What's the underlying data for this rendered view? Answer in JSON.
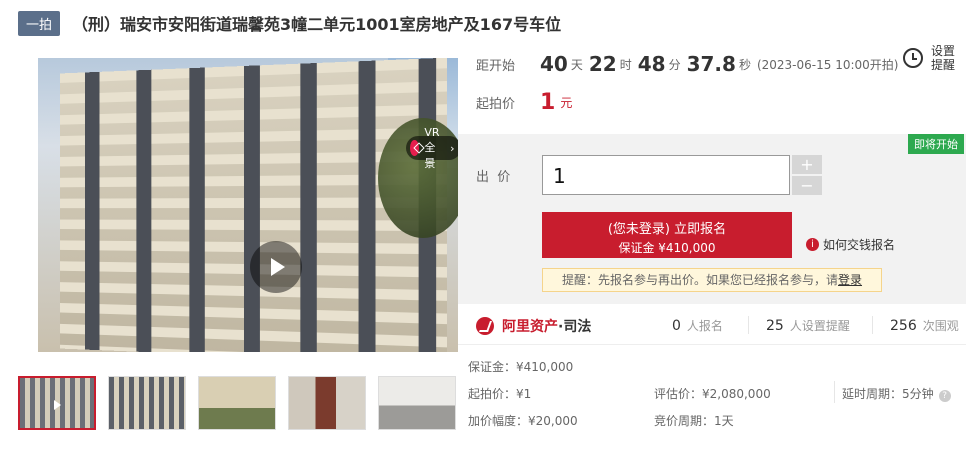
{
  "header": {
    "tag": "一拍",
    "title": "（刑）瑞安市安阳街道瑞馨苑3幢二单元1001室房地产及167号车位"
  },
  "gallery": {
    "vr_label": "VR全景",
    "vr_arrow": "›",
    "thumbnails": [
      "thumb-1",
      "thumb-2",
      "thumb-3",
      "thumb-4",
      "thumb-5"
    ]
  },
  "countdown": {
    "label": "距开始",
    "days": "40",
    "days_unit": "天",
    "hours": "22",
    "hours_unit": "时",
    "minutes": "48",
    "minutes_unit": "分",
    "seconds": "37.8",
    "seconds_unit": "秒",
    "start_time": "(2023-06-15 10:00开拍)"
  },
  "reminder": {
    "label": "设置提醒"
  },
  "start_price": {
    "label": "起拍价",
    "value": "1",
    "unit": "元"
  },
  "bid": {
    "status_badge": "即将开始",
    "label": "出  价",
    "value": "1",
    "plus": "+",
    "minus": "−",
    "signup_line1": "(您未登录) 立即报名",
    "signup_line2": "保证金 ¥410,000",
    "pay_help": "如何交钱报名",
    "tip_text": "提醒：先报名参与再出价。如果您已经报名参与，请",
    "tip_link": "登录"
  },
  "stats": {
    "brand_prefix": "阿里资产",
    "brand_suffix": "·司法",
    "signups": "0",
    "signups_label": "人报名",
    "reminders": "25",
    "reminders_label": "人设置提醒",
    "views": "256",
    "views_label": "次围观"
  },
  "details": {
    "deposit": "保证金：¥410,000",
    "start_price": "起拍价：¥1",
    "appraisal": "评估价：¥2,080,000",
    "delay_period": "延时周期：5分钟",
    "increment": "加价幅度：¥20,000",
    "auction_period": "竞价周期：1天"
  },
  "colors": {
    "accent": "#c81d2e",
    "badge_green": "#2da94f"
  }
}
